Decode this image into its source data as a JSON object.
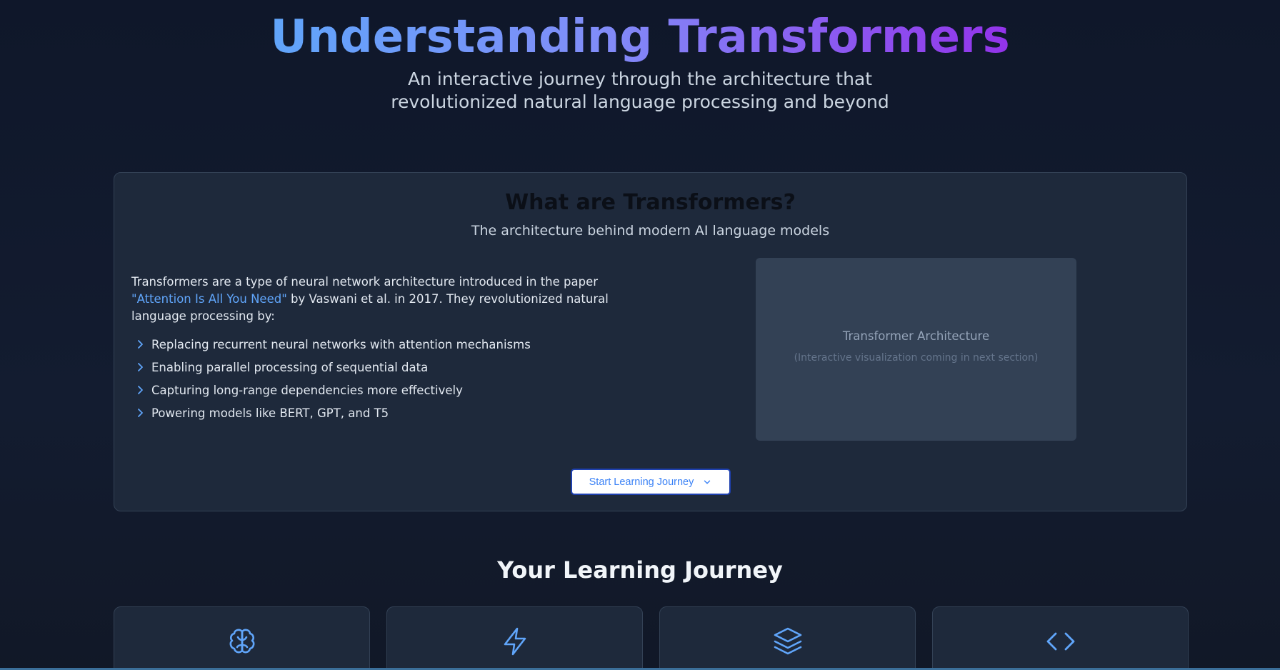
{
  "hero": {
    "title": "Understanding Transformers",
    "subtitle_line1": "An interactive journey through the architecture that",
    "subtitle_line2": "revolutionized natural language processing and beyond"
  },
  "intro": {
    "heading": "What are Transformers?",
    "subheading": "The architecture behind modern AI language models",
    "paragraph_start": "Transformers are a type of neural network architecture introduced in the paper ",
    "paper_link": "\"Attention Is All You Need\"",
    "paragraph_end": " by Vaswani et al. in 2017. They revolutionized natural language processing by:",
    "bullets": [
      "Replacing recurrent neural networks with attention mechanisms",
      "Enabling parallel processing of sequential data",
      "Capturing long-range dependencies more effectively",
      "Powering models like BERT, GPT, and T5"
    ],
    "visualization": {
      "title": "Transformer Architecture",
      "note": "(Interactive visualization coming in next section)"
    },
    "start_button": "Start Learning Journey"
  },
  "journey": {
    "heading": "Your Learning Journey",
    "cards": [
      {
        "icon": "brain-icon"
      },
      {
        "icon": "lightning-icon"
      },
      {
        "icon": "layers-icon"
      },
      {
        "icon": "code-icon"
      }
    ]
  },
  "colors": {
    "accent": "#60a5fa",
    "gradient_start": "#60a5fa",
    "gradient_end": "#9333ea",
    "background": "#0f172a",
    "card": "#1e293b"
  }
}
